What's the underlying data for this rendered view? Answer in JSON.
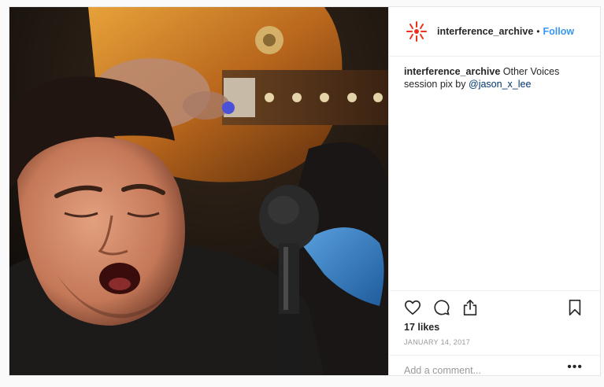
{
  "post": {
    "username": "interference_archive",
    "separator": "•",
    "follow_label": "Follow",
    "caption": {
      "username": "interference_archive",
      "text": "Other Voices session pix by",
      "mention": "@jason_x_lee"
    },
    "likes": "17 likes",
    "date": "JANUARY 14, 2017",
    "comment_placeholder": "Add a comment...",
    "more_label": "•••"
  },
  "icons": {
    "like": "heart-icon",
    "comment": "comment-icon",
    "share": "share-icon",
    "save": "bookmark-icon",
    "more": "more-options-icon",
    "avatar": "interference-archive-logo"
  },
  "colors": {
    "link": "#3897f0",
    "logo": "#e8321e",
    "border": "#efefef",
    "muted": "#999999"
  }
}
